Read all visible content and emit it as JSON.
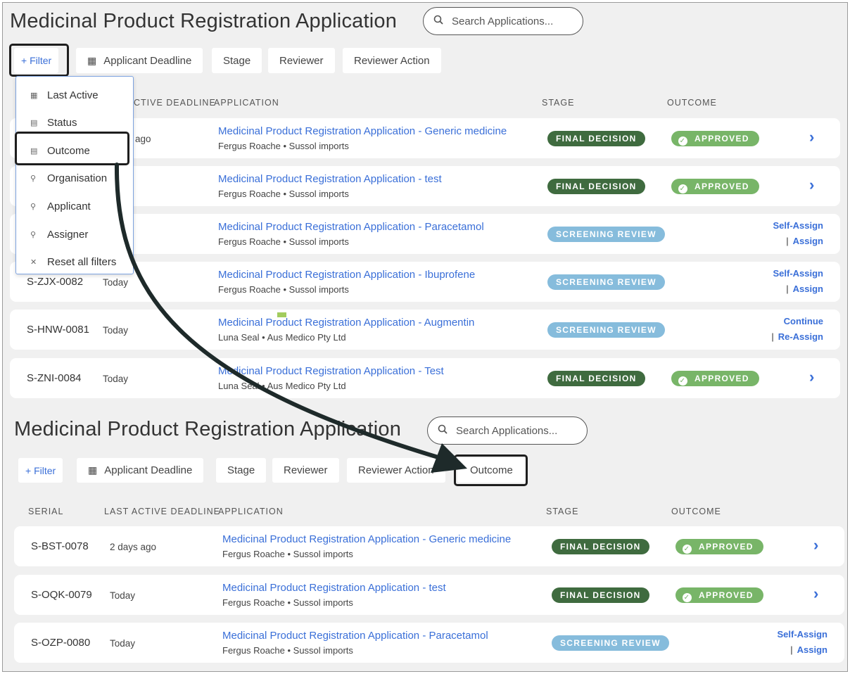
{
  "top": {
    "title": "Medicinal Product Registration Application",
    "search_placeholder": "Search Applications...",
    "filters": {
      "filter_label": "+ Filter",
      "applicant_deadline": "Applicant Deadline",
      "stage": "Stage",
      "reviewer": "Reviewer",
      "reviewer_action": "Reviewer Action"
    },
    "headers": {
      "last_active_deadline": "CTIVE DEADLINE",
      "application": "APPLICATION",
      "stage": "STAGE",
      "outcome": "OUTCOME"
    },
    "dropdown": [
      {
        "label": "Last Active",
        "icon": "calendar-icon"
      },
      {
        "label": "Status",
        "icon": "list-icon"
      },
      {
        "label": "Outcome",
        "icon": "list-icon"
      },
      {
        "label": "Organisation",
        "icon": "search-icon"
      },
      {
        "label": "Applicant",
        "icon": "search-icon"
      },
      {
        "label": "Assigner",
        "icon": "search-icon"
      },
      {
        "label": "Reset all filters",
        "icon": "close-icon"
      }
    ],
    "rows": [
      {
        "serial": "",
        "last_active": "ago",
        "app_title": "Medicinal Product Registration Application - Generic medicine",
        "app_sub": "Fergus Roache • Sussol imports",
        "stage": "FINAL DECISION",
        "outcome": "APPROVED"
      },
      {
        "serial": "",
        "last_active": "",
        "app_title": "Medicinal Product Registration Application - test",
        "app_sub": "Fergus Roache • Sussol imports",
        "stage": "FINAL DECISION",
        "outcome": "APPROVED"
      },
      {
        "serial": "",
        "last_active": "",
        "app_title": "Medicinal Product Registration Application - Paracetamol",
        "app_sub": "Fergus Roache • Sussol imports",
        "stage": "SCREENING REVIEW",
        "action1": "Self-Assign",
        "action2": "Assign"
      },
      {
        "serial": "S-ZJX-0082",
        "last_active": "Today",
        "app_title": "Medicinal Product Registration Application - Ibuprofene",
        "app_sub": "Fergus Roache • Sussol imports",
        "stage": "SCREENING REVIEW",
        "action1": "Self-Assign",
        "action2": "Assign"
      },
      {
        "serial": "S-HNW-0081",
        "last_active": "Today",
        "app_title": "Medicinal Product Registration Application - Augmentin",
        "app_sub": "Luna Seal • Aus Medico Pty Ltd",
        "stage": "SCREENING REVIEW",
        "action1": "Continue",
        "action2": "Re-Assign"
      },
      {
        "serial": "S-ZNI-0084",
        "last_active": "Today",
        "app_title": "Medicinal Product Registration Application - Test",
        "app_sub": "Luna Seal • Aus Medico Pty Ltd",
        "stage": "FINAL DECISION",
        "outcome": "APPROVED"
      }
    ]
  },
  "bottom": {
    "title": "Medicinal Product Registration Application",
    "search_placeholder": "Search Applications...",
    "filters": {
      "filter_label": "+ Filter",
      "applicant_deadline": "Applicant Deadline",
      "stage": "Stage",
      "reviewer": "Reviewer",
      "reviewer_action": "Reviewer Action",
      "outcome": "Outcome"
    },
    "headers": {
      "serial": "SERIAL",
      "last_active_deadline": "LAST ACTIVE DEADLINE",
      "application": "APPLICATION",
      "stage": "STAGE",
      "outcome": "OUTCOME"
    },
    "rows": [
      {
        "serial": "S-BST-0078",
        "last_active": "2 days ago",
        "app_title": "Medicinal Product Registration Application - Generic medicine",
        "app_sub": "Fergus Roache • Sussol imports",
        "stage": "FINAL DECISION",
        "outcome": "APPROVED"
      },
      {
        "serial": "S-OQK-0079",
        "last_active": "Today",
        "app_title": "Medicinal Product Registration Application - test",
        "app_sub": "Fergus Roache • Sussol imports",
        "stage": "FINAL DECISION",
        "outcome": "APPROVED"
      },
      {
        "serial": "S-OZP-0080",
        "last_active": "Today",
        "app_title": "Medicinal Product Registration Application - Paracetamol",
        "app_sub": "Fergus Roache • Sussol imports",
        "stage": "SCREENING REVIEW",
        "action1": "Self-Assign",
        "action2": "Assign"
      }
    ]
  },
  "colors": {
    "link_blue": "#3a6fd8",
    "final_decision": "#3f6b3f",
    "screening_review": "#86bcdc",
    "approved": "#78b568"
  }
}
